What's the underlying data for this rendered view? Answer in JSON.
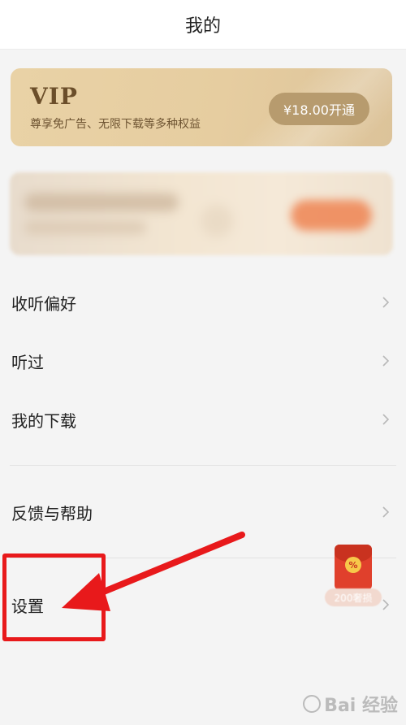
{
  "header": {
    "title": "我的"
  },
  "vip": {
    "title": "VIP",
    "description": "尊享免广告、无限下载等多种权益",
    "button_label": "¥18.00开通"
  },
  "menu": {
    "items": [
      {
        "label": "收听偏好",
        "icon": "chevron-right-icon"
      },
      {
        "label": "听过",
        "icon": "chevron-right-icon"
      },
      {
        "label": "我的下载",
        "icon": "chevron-right-icon"
      },
      {
        "label": "反馈与帮助",
        "icon": "chevron-right-icon"
      },
      {
        "label": "设置",
        "icon": "chevron-right-icon"
      }
    ]
  },
  "red_packet": {
    "icon": "red-envelope-icon",
    "coin_symbol": "%",
    "tag": "200奢损"
  },
  "watermark": {
    "text": "Bai 经验"
  },
  "colors": {
    "vip_gold": "#e6cda0",
    "vip_button": "#b79b6e",
    "annotation_red": "#e8191b",
    "background": "#f4f4f4"
  }
}
